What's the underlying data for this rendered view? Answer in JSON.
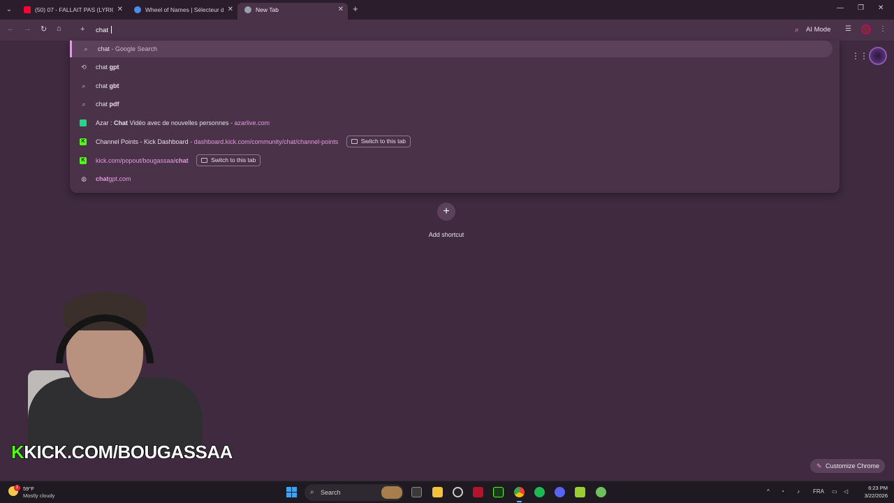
{
  "tabs": [
    {
      "title": "(50) 07 - FALLAIT PAS (LYRIC VIDEO)",
      "favicon_color": "#ff0033"
    },
    {
      "title": "Wheel of Names | Sélecteur de",
      "favicon_color": "#4a8ee6"
    },
    {
      "title": "New Tab",
      "favicon_color": "#9aa0a6"
    }
  ],
  "omnibox": {
    "value": "chat "
  },
  "toolbar": {
    "ai_mode_label": "AI Mode"
  },
  "suggestions": [
    {
      "query": "chat",
      "separator": " - ",
      "description": "Google Search"
    },
    {
      "query": "chat ",
      "completion": "gpt"
    },
    {
      "query": "chat ",
      "completion": "gbt"
    },
    {
      "query": "chat ",
      "completion": "pdf"
    },
    {
      "title_prefix": "Azar : ",
      "title_bold": "Chat",
      "title_suffix": " Vidéo avec de nouvelles personnes",
      "separator": " - ",
      "url": "azarlive.com"
    },
    {
      "title": "Channel Points - Kick Dashboard",
      "separator": " - ",
      "url_prefix": "dashboard.kick.com/community/",
      "url_bold": "chat",
      "url_suffix": "/channel-points",
      "switch_label": "Switch to this tab"
    },
    {
      "url_prefix": "kick.com/popout/bougassaa/",
      "url_bold": "chat",
      "switch_label": "Switch to this tab"
    },
    {
      "url_bold": "chat",
      "url_suffix": "gpt.com"
    }
  ],
  "shortcut": {
    "label": "Add shortcut"
  },
  "overlay": {
    "banner_k": "K",
    "banner_text": "KICK.COM/BOUGASSAA"
  },
  "customize_label": "Customize Chrome",
  "taskbar": {
    "weather_temp": "59°F",
    "weather_desc": "Mostly cloudy",
    "weather_badge": "1",
    "search_label": "Search",
    "language": "FRA",
    "time": "6:23 PM",
    "date": "3/22/2026"
  },
  "colors": {
    "accent": "#e39be0",
    "kick_green": "#53fc18",
    "background": "#3f2a40"
  }
}
